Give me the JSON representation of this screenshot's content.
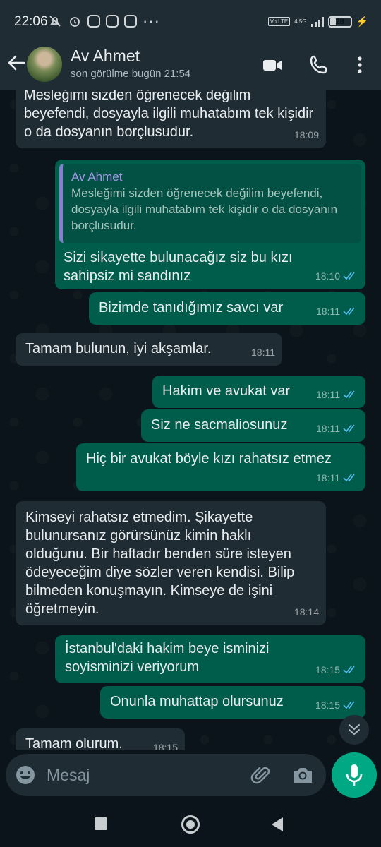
{
  "status_bar": {
    "time": "22:06",
    "network": "4.5G",
    "volte": "Vo LTE",
    "battery": "28",
    "more": "···"
  },
  "header": {
    "contact_name": "Av Ahmet",
    "last_seen": "son görülme bugün 21:54"
  },
  "messages": [
    {
      "direction": "in",
      "text": "Mesleğimi sizden öğrenecek değilim beyefendi, dosyayla ilgili muhatabım tek kişidir o da dosyanın borçlusudur.",
      "time": "18:09"
    },
    {
      "direction": "out",
      "quote_author": "Av Ahmet",
      "quote_text": "Mesleğimi sizden öğrenecek değilim beyefendi, dosyayla ilgili muhatabım tek kişidir o da dosyanın borçlusudur.",
      "text": "Sizi sikayette bulunacağız siz bu kızı sahipsiz mi sandınız",
      "time": "18:10",
      "status": "read"
    },
    {
      "direction": "out",
      "text": "Bizimde tanıdığımız savcı var",
      "time": "18:11",
      "status": "read"
    },
    {
      "direction": "in",
      "text": "Tamam bulunun, iyi akşamlar.",
      "time": "18:11"
    },
    {
      "direction": "out",
      "text": "Hakim ve avukat var",
      "time": "18:11",
      "status": "read"
    },
    {
      "direction": "out",
      "text": "Siz ne sacmaliosunuz",
      "time": "18:11",
      "status": "read"
    },
    {
      "direction": "out",
      "text": "Hiç bir avukat böyle kızı rahatsız etmez",
      "time": "18:11",
      "status": "read"
    },
    {
      "direction": "in",
      "text": "Kimseyi rahatsız etmedim. Şikayette bulunursanız görürsünüz kimin haklı olduğunu. Bir haftadır benden süre isteyen ödeyeceğim diye sözler veren kendisi. Bilip bilmeden konuşmayın. Kimseye de işini öğretmeyin.",
      "time": "18:14"
    },
    {
      "direction": "out",
      "text": "İstanbul'daki hakim beye isminizi soyisminizi veriyorum",
      "time": "18:15",
      "status": "read"
    },
    {
      "direction": "out",
      "text": "Onunla muhattap olursunuz",
      "time": "18:15",
      "status": "read"
    },
    {
      "direction": "in",
      "text": "Tamam olurum.",
      "time": "18:15"
    }
  ],
  "input": {
    "placeholder": "Mesaj",
    "value": ""
  },
  "colors": {
    "incoming_bubble": "#1f2c34",
    "outgoing_bubble": "#005c4b",
    "read_ticks": "#53bdeb",
    "accent": "#00a884"
  },
  "icons": {
    "back": "arrow-left-icon",
    "video": "video-camera-icon",
    "call": "phone-icon",
    "menu": "more-vertical-icon",
    "scroll": "double-chevron-down-icon",
    "emoji": "emoji-icon",
    "attach": "paperclip-icon",
    "camera": "camera-icon",
    "mic": "microphone-icon"
  }
}
